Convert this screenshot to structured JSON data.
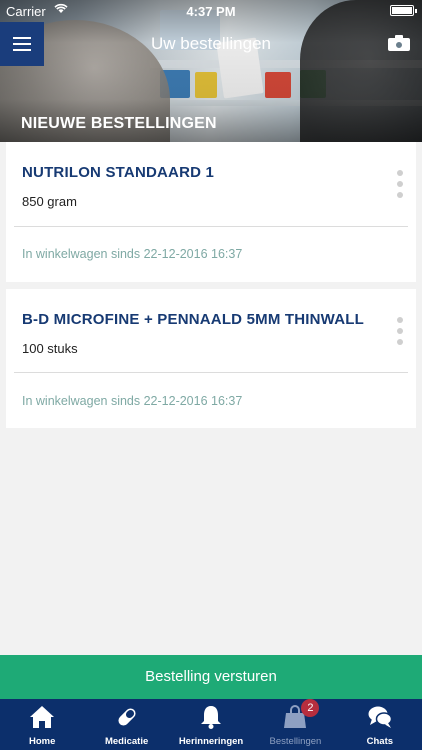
{
  "status_bar": {
    "carrier": "Carrier",
    "time": "4:37 PM"
  },
  "nav": {
    "title": "Uw bestellingen",
    "menu_icon": "menu-icon",
    "camera_icon": "camera-icon"
  },
  "section": {
    "title": "NIEUWE BESTELLINGEN"
  },
  "orders": [
    {
      "name": "NUTRILON STANDAARD 1",
      "quantity": "850 gram",
      "since": "In winkelwagen sinds 22-12-2016 16:37"
    },
    {
      "name": "B-D MICROFINE + PENNAALD  5MM THINWALL",
      "quantity": "100 stuks",
      "since": "In winkelwagen sinds 22-12-2016 16:37"
    }
  ],
  "submit_label": "Bestelling versturen",
  "tabs": [
    {
      "label": "Home",
      "icon": "home-icon"
    },
    {
      "label": "Medicatie",
      "icon": "pill-icon"
    },
    {
      "label": "Herinneringen",
      "icon": "bell-icon"
    },
    {
      "label": "Bestellingen",
      "icon": "shopping-bag-icon",
      "badge": "2",
      "active": true
    },
    {
      "label": "Chats",
      "icon": "chat-bubbles-icon"
    }
  ],
  "colors": {
    "nav_blue": "#0c2f6b",
    "menu_blue": "#1a3d7c",
    "accent_green": "#1eaa76",
    "title_blue": "#173a73",
    "since_teal": "#7fa9a4",
    "badge_red": "#b72e3e"
  }
}
